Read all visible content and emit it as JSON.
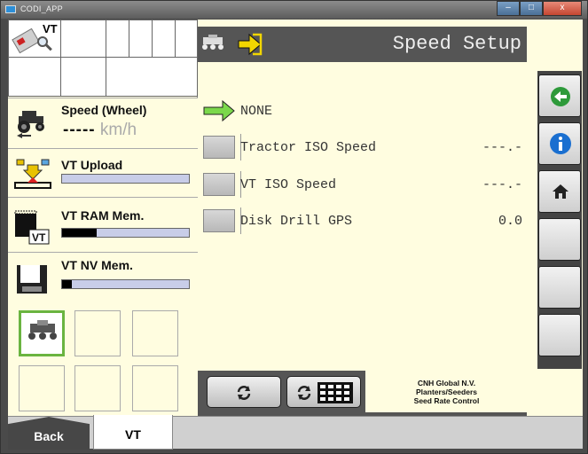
{
  "window": {
    "title": "CODI_APP",
    "controls": [
      "–",
      "□",
      "x"
    ]
  },
  "left": {
    "vt_label": "VT",
    "speed": {
      "label": "Speed (Wheel)",
      "value": "-----",
      "unit": "km/h"
    },
    "upload": {
      "label": "VT Upload",
      "progress": 0.0
    },
    "ram": {
      "label": "VT RAM Mem.",
      "progress": 0.27
    },
    "nv": {
      "label": "VT NV Mem.",
      "progress": 0.08
    }
  },
  "main": {
    "title": "Speed Setup",
    "rows": [
      {
        "label": "NONE",
        "value": "",
        "selected": true
      },
      {
        "label": "Tractor ISO Speed",
        "value": "---.-"
      },
      {
        "label": "VT ISO Speed",
        "value": "---.-"
      },
      {
        "label": "Disk Drill GPS",
        "value": "0.0"
      }
    ],
    "footer": [
      "CNH Global N.V.",
      "Planters/Seeders",
      "Seed Rate Control"
    ]
  },
  "softkeys": [
    "back-arrow-icon",
    "info-icon",
    "home-icon",
    "",
    "",
    ""
  ],
  "tabs": {
    "back": "Back",
    "vt": "VT"
  },
  "colors": {
    "panel_bg": "#fffde0",
    "accent_green": "#6ab440",
    "info_blue": "#1a6fd0"
  }
}
